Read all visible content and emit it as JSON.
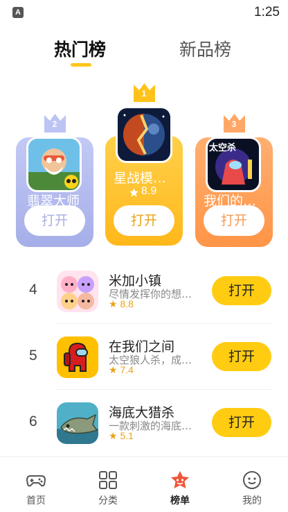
{
  "status_bar": {
    "app_icon_letter": "A",
    "time": "1:25"
  },
  "top_tabs": {
    "active": "热门榜",
    "inactive": "新品榜"
  },
  "podium": {
    "first": {
      "rank": "1",
      "name": "星战模…",
      "rating": "8.9",
      "button": "打开",
      "color": "#ffc233"
    },
    "second": {
      "rank": "2",
      "name": "翡翠大师",
      "button": "打开",
      "color": "#aeb6ef"
    },
    "third": {
      "rank": "3",
      "name": "我们的…",
      "button": "打开",
      "color": "#ffa060"
    },
    "second_icon_label": "",
    "third_icon_label": "太空杀"
  },
  "list": [
    {
      "rank": "4",
      "title": "米加小镇",
      "desc": "尽情发挥你的想…",
      "rating": "8.8",
      "button": "打开"
    },
    {
      "rank": "5",
      "title": "在我们之间",
      "desc": "太空狼人杀，成…",
      "rating": "7.4",
      "button": "打开"
    },
    {
      "rank": "6",
      "title": "海底大猎杀",
      "desc": "一款刺激的海底…",
      "rating": "5.1",
      "button": "打开"
    }
  ],
  "bottom_nav": [
    {
      "label": "首页",
      "icon": "gamepad-icon"
    },
    {
      "label": "分类",
      "icon": "grid-icon"
    },
    {
      "label": "榜单",
      "icon": "ranking-star-icon",
      "active": true
    },
    {
      "label": "我的",
      "icon": "smiley-icon"
    }
  ]
}
